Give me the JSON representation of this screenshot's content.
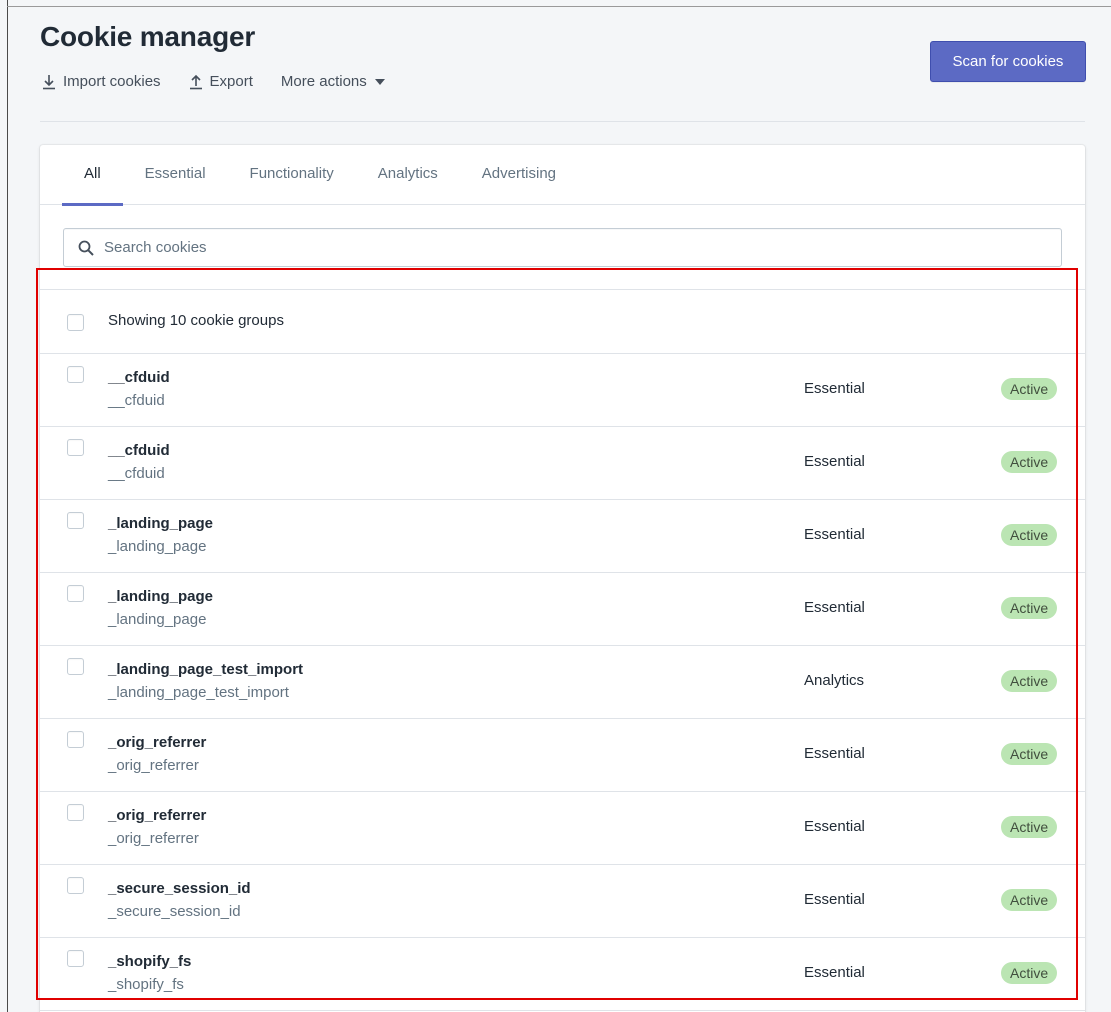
{
  "header": {
    "title": "Cookie manager",
    "import_label": "Import cookies",
    "export_label": "Export",
    "more_actions_label": "More actions",
    "scan_button_label": "Scan for cookies"
  },
  "tabs": [
    {
      "label": "All",
      "active": true
    },
    {
      "label": "Essential",
      "active": false
    },
    {
      "label": "Functionality",
      "active": false
    },
    {
      "label": "Analytics",
      "active": false
    },
    {
      "label": "Advertising",
      "active": false
    }
  ],
  "search": {
    "placeholder": "Search cookies",
    "value": ""
  },
  "list": {
    "header_text": "Showing 10 cookie groups",
    "rows": [
      {
        "name": "__cfduid",
        "sub": "__cfduid",
        "category": "Essential",
        "status": "Active"
      },
      {
        "name": "__cfduid",
        "sub": "__cfduid",
        "category": "Essential",
        "status": "Active"
      },
      {
        "name": "_landing_page",
        "sub": "_landing_page",
        "category": "Essential",
        "status": "Active"
      },
      {
        "name": "_landing_page",
        "sub": "_landing_page",
        "category": "Essential",
        "status": "Active"
      },
      {
        "name": "_landing_page_test_import",
        "sub": "_landing_page_test_import",
        "category": "Analytics",
        "status": "Active"
      },
      {
        "name": "_orig_referrer",
        "sub": "_orig_referrer",
        "category": "Essential",
        "status": "Active"
      },
      {
        "name": "_orig_referrer",
        "sub": "_orig_referrer",
        "category": "Essential",
        "status": "Active"
      },
      {
        "name": "_secure_session_id",
        "sub": "_secure_session_id",
        "category": "Essential",
        "status": "Active"
      },
      {
        "name": "_shopify_fs",
        "sub": "_shopify_fs",
        "category": "Essential",
        "status": "Active"
      }
    ]
  },
  "colors": {
    "accent": "#5c6ac4",
    "badge_bg": "#bbe5b3",
    "highlight": "#e00000"
  },
  "icons": {
    "import": "download-arrow-icon",
    "export": "upload-arrow-icon",
    "more": "caret-down-icon",
    "search": "magnifier-icon"
  }
}
